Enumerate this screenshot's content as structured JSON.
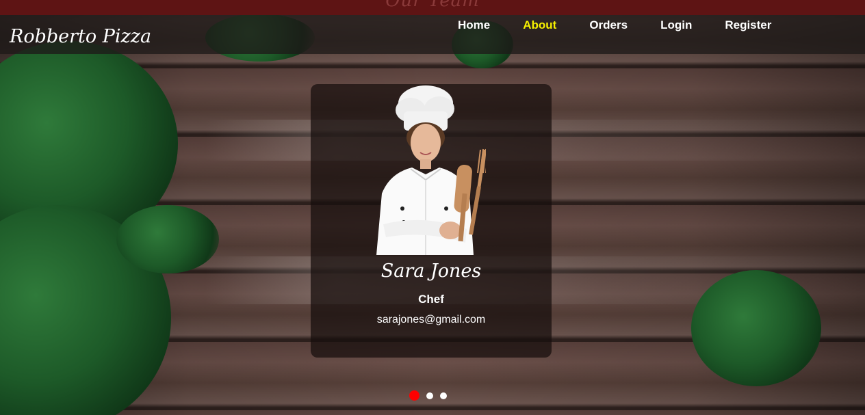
{
  "section_heading": "Our Team",
  "brand": "Robberto Pizza",
  "nav": {
    "items": [
      {
        "label": "Home",
        "active": false
      },
      {
        "label": "About",
        "active": true
      },
      {
        "label": "Orders",
        "active": false
      },
      {
        "label": "Login",
        "active": false
      },
      {
        "label": "Register",
        "active": false
      }
    ]
  },
  "team_card": {
    "name": "Sara Jones",
    "role": "Chef",
    "email": "sarajones@gmail.com"
  },
  "carousel": {
    "total_slides": 3,
    "active_index": 0
  },
  "colors": {
    "active_nav": "#f6f000",
    "active_dot": "#ff0000",
    "top_strip": "#5e1414"
  }
}
